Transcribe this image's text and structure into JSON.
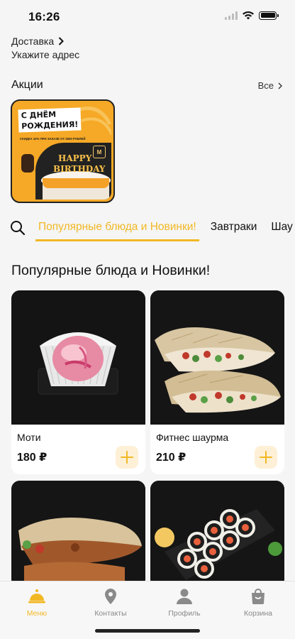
{
  "status": {
    "time": "16:26"
  },
  "delivery": {
    "label": "Доставка",
    "address": "Укажите адрес"
  },
  "promo": {
    "title": "Акции",
    "all_label": "Все",
    "banner_line1": "С ДНЁМ",
    "banner_line2": "РОЖДЕНИЯ!",
    "subtitle": "СКИДКА 10% ПРИ ЗАКАЗЕ ОТ 2500 РУБЛЕЙ",
    "happy": "HAPPY",
    "birthday": "BIRTHDAY"
  },
  "categories": {
    "tabs": [
      {
        "label": "Популярные блюда и Новинки!"
      },
      {
        "label": "Завтраки"
      },
      {
        "label": "Шау"
      }
    ],
    "active_index": 0
  },
  "section": {
    "title": "Популярные блюда и Новинки!"
  },
  "products": [
    {
      "name": "Моти",
      "price": "180 ₽"
    },
    {
      "name": "Фитнес шаурма",
      "price": "210 ₽"
    },
    {
      "name": "",
      "price": ""
    },
    {
      "name": "",
      "price": ""
    }
  ],
  "tabbar": {
    "items": [
      {
        "label": "Меню",
        "icon": "cloche-icon"
      },
      {
        "label": "Контакты",
        "icon": "location-pin-icon"
      },
      {
        "label": "Профиль",
        "icon": "person-icon"
      },
      {
        "label": "Корзина",
        "icon": "shopping-bag-icon"
      }
    ]
  },
  "colors": {
    "accent": "#f2b824",
    "accent_soft": "#fdf0d6",
    "background": "#f5f5f5"
  }
}
